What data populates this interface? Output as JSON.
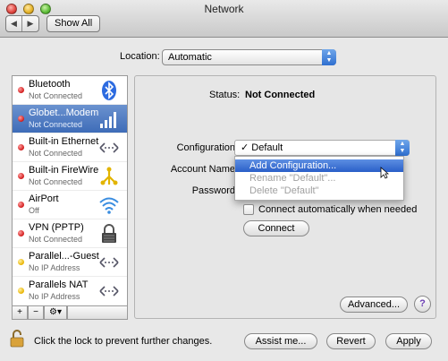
{
  "window": {
    "title": "Network"
  },
  "toolbar": {
    "back_label": "◀",
    "forward_label": "▶",
    "show_all_label": "Show All"
  },
  "location": {
    "label": "Location:",
    "value": "Automatic"
  },
  "services": [
    {
      "name": "Bluetooth",
      "status": "Not Connected",
      "icon": "bluetooth-icon",
      "dot": "red"
    },
    {
      "name": "Globet...Modem",
      "status": "Not Connected",
      "icon": "signal-bars-icon",
      "dot": "red",
      "selected": true
    },
    {
      "name": "Built-in Ethernet",
      "status": "Not Connected",
      "icon": "ethernet-icon",
      "dot": "red"
    },
    {
      "name": "Built-in FireWire",
      "status": "Not Connected",
      "icon": "firewire-icon",
      "dot": "red"
    },
    {
      "name": "AirPort",
      "status": "Off",
      "icon": "airport-wifi-icon",
      "dot": "red"
    },
    {
      "name": "VPN (PPTP)",
      "status": "Not Connected",
      "icon": "vpn-lock-icon",
      "dot": "red"
    },
    {
      "name": "Parallel...-Guest",
      "status": "No IP Address",
      "icon": "ethernet-icon",
      "dot": "yellow"
    },
    {
      "name": "Parallels NAT",
      "status": "No IP Address",
      "icon": "ethernet-icon",
      "dot": "yellow"
    }
  ],
  "sidebar_tools": {
    "add": "+",
    "remove": "−",
    "action": "⚙▾"
  },
  "detail": {
    "status_label": "Status:",
    "status_value": "Not Connected",
    "configuration_label": "Configuration",
    "configuration_value": "✓ Default",
    "account_label": "Account Name",
    "password_label": "Password",
    "menu_items": [
      {
        "label": "Add Configuration...",
        "state": "highlighted"
      },
      {
        "label": "Rename \"Default\"...",
        "state": "disabled"
      },
      {
        "label": "Delete \"Default\"",
        "state": "disabled"
      }
    ],
    "auto_connect_label": "Connect automatically when needed",
    "connect_label": "Connect",
    "advanced_label": "Advanced...",
    "help_label": "?"
  },
  "footer": {
    "lock_text": "Click the lock to prevent further changes.",
    "assist_label": "Assist me...",
    "revert_label": "Revert",
    "apply_label": "Apply"
  }
}
